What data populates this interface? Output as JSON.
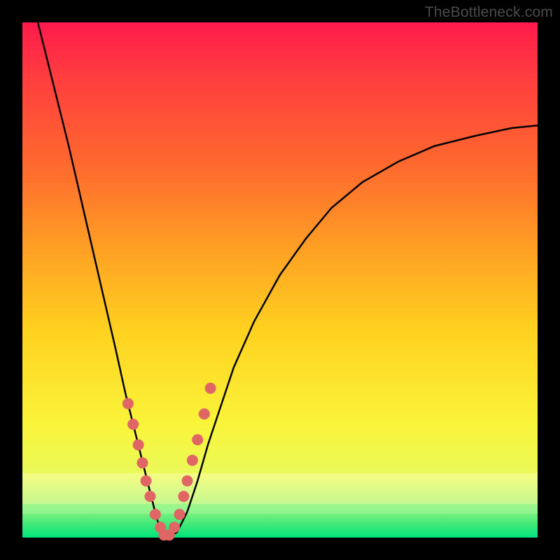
{
  "watermark": {
    "text": "TheBottleneck.com"
  },
  "colors": {
    "curve_stroke": "#000000",
    "marker_fill": "#e06666",
    "frame_bg": "#000000",
    "gradient_css": "background: linear-gradient(to bottom, #ff1a4d 0%, #ff3b3f 10%, #ff6a2e 28%, #ffa024 44%, #ffd21f 60%, #faf43a 78%, #e9fa5a 88%, #7df07a 95%, #00e37a 100%);"
  },
  "chart_data": {
    "type": "line",
    "title": "",
    "xlabel": "",
    "ylabel": "",
    "xlim": [
      0,
      100
    ],
    "ylim": [
      0,
      100
    ],
    "series": [
      {
        "name": "bottleneck-curve",
        "x": [
          3,
          6,
          9,
          12,
          15,
          18,
          20,
          22,
          24,
          25,
          26,
          27,
          28,
          30,
          32,
          34,
          36,
          38,
          41,
          45,
          50,
          55,
          60,
          66,
          73,
          80,
          88,
          95,
          100
        ],
        "y": [
          100,
          88,
          76,
          63,
          50,
          37,
          28,
          20,
          12,
          8,
          4,
          1,
          0,
          1,
          5,
          11,
          18,
          24,
          33,
          42,
          51,
          58,
          64,
          69,
          73,
          76,
          78,
          79.5,
          80
        ]
      }
    ],
    "markers": {
      "name": "sample-points",
      "x": [
        20.5,
        21.5,
        22.5,
        23.3,
        24.0,
        24.8,
        25.8,
        26.8,
        27.5,
        28.5,
        29.5,
        30.5,
        31.3,
        32.0,
        33.0,
        34.0,
        35.3,
        36.5
      ],
      "y": [
        26,
        22,
        18,
        14.5,
        11,
        8,
        4.5,
        2,
        0.5,
        0.5,
        2,
        4.5,
        8,
        11,
        15,
        19,
        24,
        29
      ]
    },
    "annotations": [
      {
        "text": "TheBottleneck.com",
        "role": "watermark",
        "pos": "top-right"
      }
    ]
  }
}
